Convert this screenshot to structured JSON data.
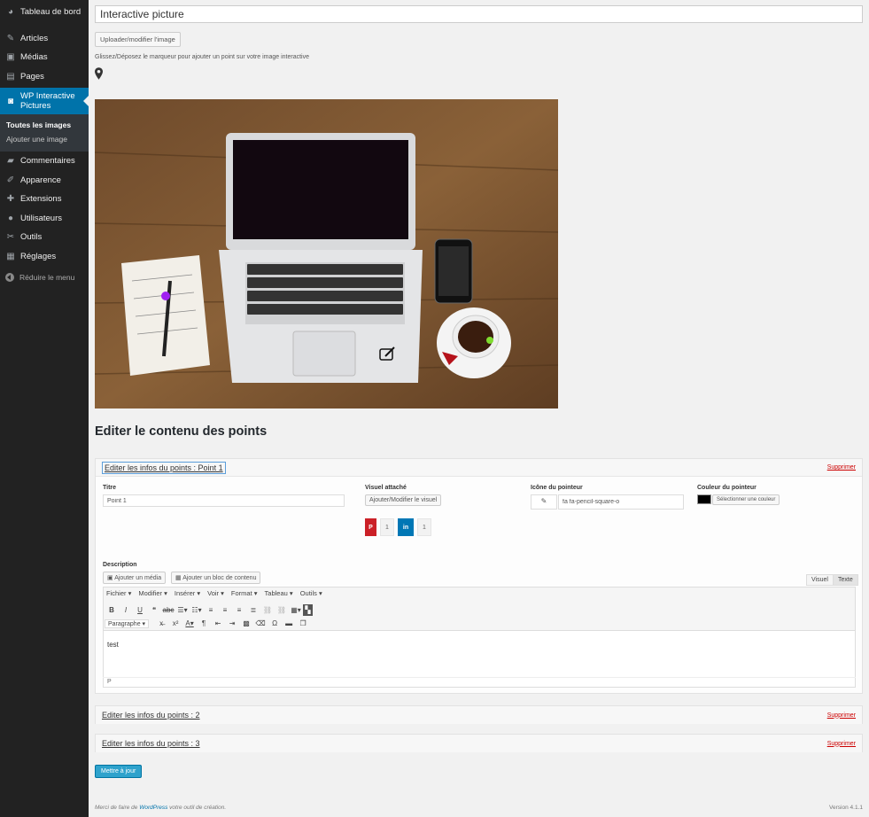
{
  "sidebar": {
    "items": [
      {
        "label": "Tableau de bord",
        "icon": "dashboard-icon",
        "glyph": "◕"
      },
      {
        "label": "Articles",
        "icon": "pin-icon",
        "glyph": "✎"
      },
      {
        "label": "Médias",
        "icon": "media-icon",
        "glyph": "▣"
      },
      {
        "label": "Pages",
        "icon": "pages-icon",
        "glyph": "▤"
      },
      {
        "label": "WP Interactive Pictures",
        "icon": "camera-icon",
        "glyph": "◙"
      },
      {
        "label": "Commentaires",
        "icon": "comment-icon",
        "glyph": "▰"
      },
      {
        "label": "Apparence",
        "icon": "brush-icon",
        "glyph": "✐"
      },
      {
        "label": "Extensions",
        "icon": "plug-icon",
        "glyph": "✚"
      },
      {
        "label": "Utilisateurs",
        "icon": "users-icon",
        "glyph": "●"
      },
      {
        "label": "Outils",
        "icon": "wrench-icon",
        "glyph": "✂"
      },
      {
        "label": "Réglages",
        "icon": "settings-icon",
        "glyph": "▦"
      }
    ],
    "submenu": [
      "Toutes les images",
      "Ajouter une image"
    ],
    "collapse_label": "Réduire le menu"
  },
  "editor": {
    "title_value": "Interactive picture",
    "upload_button": "Uploader/modifier l'image",
    "hint": "Glissez/Déposez le marqueur pour ajouter un point sur votre image interactive"
  },
  "section_title": "Editer le contenu des points",
  "point1": {
    "header": "Editer les infos du points : Point 1",
    "delete": "Supprimer",
    "titre_label": "Titre",
    "titre_value": "Point 1",
    "visuel_label": "Visuel attaché",
    "visuel_button": "Ajouter/Modifier le visuel",
    "icon_label": "Icône du pointeur",
    "icon_value": "fa fa-pencil-square-o",
    "color_label": "Couleur du pointeur",
    "color_button": "Sélectionner une couleur",
    "color_value": "#000000",
    "pinterest_count": "1",
    "linkedin_count": "1",
    "description_label": "Description",
    "add_media": "Ajouter un média",
    "add_block": "Ajouter un bloc de contenu",
    "tab_visual": "Visuel",
    "tab_text": "Texte",
    "menus": [
      "Fichier",
      "Modifier",
      "Insérer",
      "Voir",
      "Format",
      "Tableau",
      "Outils"
    ],
    "paragraph_select": "Paragraphe",
    "content": "test",
    "path": "P"
  },
  "point2": {
    "header": "Editer les infos du points : 2",
    "delete": "Supprimer"
  },
  "point3": {
    "header": "Editer les infos du points : 3",
    "delete": "Supprimer"
  },
  "update_button": "Mettre à jour",
  "footer": {
    "prefix": "Merci de faire de ",
    "link": "WordPress",
    "suffix": " votre outil de création.",
    "version": "Version 4.1.1"
  },
  "colors": {
    "accent": "#0073aa",
    "sidebar": "#222222",
    "update": "#2ea2cc",
    "pinterest": "#cb2027",
    "linkedin": "#0077b5"
  }
}
